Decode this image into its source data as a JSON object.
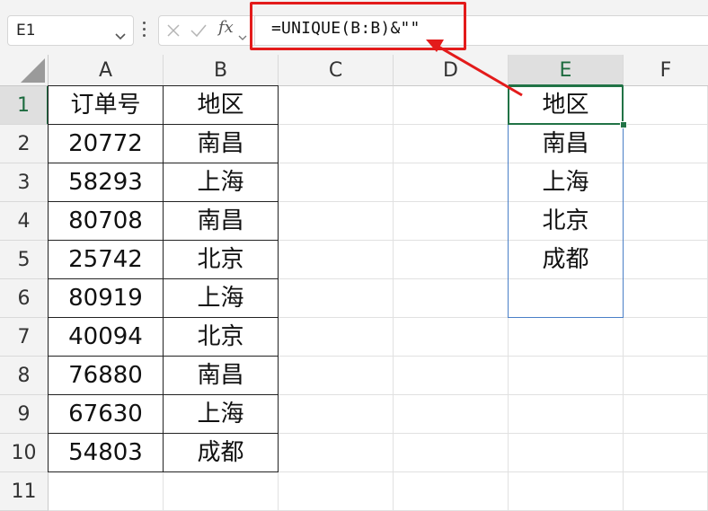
{
  "name_box": {
    "value": "E1"
  },
  "formula_bar": {
    "fx_label": "fx",
    "formula": "=UNIQUE(B:B)&\"\""
  },
  "columns": [
    "A",
    "B",
    "C",
    "D",
    "E",
    "F"
  ],
  "rows": [
    "1",
    "2",
    "3",
    "4",
    "5",
    "6",
    "7",
    "8",
    "9",
    "10",
    "11"
  ],
  "cells": {
    "A": [
      "订单号",
      "20772",
      "58293",
      "80708",
      "25742",
      "80919",
      "40094",
      "76880",
      "67630",
      "54803",
      ""
    ],
    "B": [
      "地区",
      "南昌",
      "上海",
      "南昌",
      "北京",
      "上海",
      "北京",
      "南昌",
      "上海",
      "成都",
      ""
    ],
    "E": [
      "地区",
      "南昌",
      "上海",
      "北京",
      "成都",
      "",
      ""
    ]
  },
  "selection": {
    "active_cell": "E1",
    "active_column": "E",
    "active_row": "1"
  },
  "colors": {
    "accent_green": "#217346",
    "highlight_red": "#e31b1b",
    "range_blue": "#4a7fc7"
  }
}
